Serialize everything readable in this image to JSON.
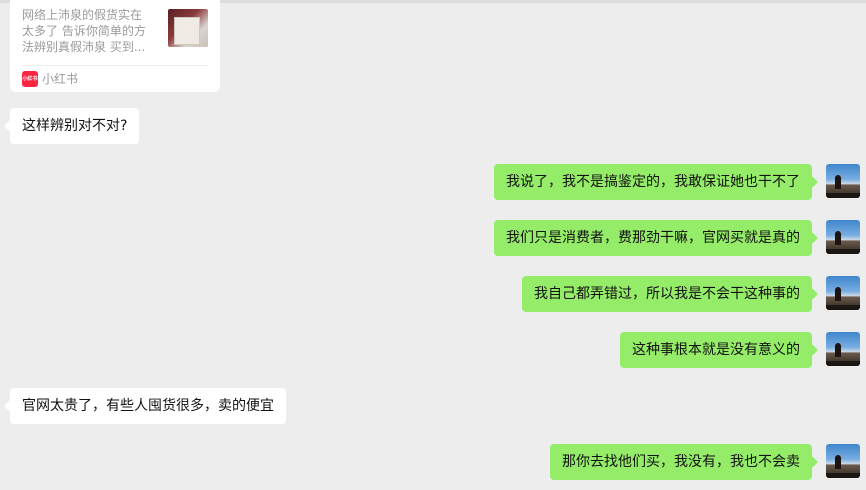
{
  "shared_card": {
    "text": "网络上沛泉的假货实在太多了 告诉你简单的方法辨别真假沛泉 买到...",
    "source_logo_text": "小红书",
    "source_name": "小红书"
  },
  "messages": [
    {
      "side": "incoming",
      "text": "这样辨别对不对?"
    },
    {
      "side": "outgoing",
      "text": "我说了，我不是搞鉴定的，我敢保证她也干不了"
    },
    {
      "side": "outgoing",
      "text": "我们只是消费者，费那劲干嘛，官网买就是真的"
    },
    {
      "side": "outgoing",
      "text": "我自己都弄错过，所以我是不会干这种事的"
    },
    {
      "side": "outgoing",
      "text": "这种事根本就是没有意义的"
    },
    {
      "side": "incoming",
      "text": "官网太贵了，有些人囤货很多，卖的便宜"
    },
    {
      "side": "outgoing",
      "text": "那你去找他们买，我没有，我也不会卖"
    }
  ],
  "colors": {
    "background": "#ededed",
    "incoming_bubble": "#ffffff",
    "outgoing_bubble": "#95ec69",
    "xiaohongshu_red": "#ff2442"
  }
}
